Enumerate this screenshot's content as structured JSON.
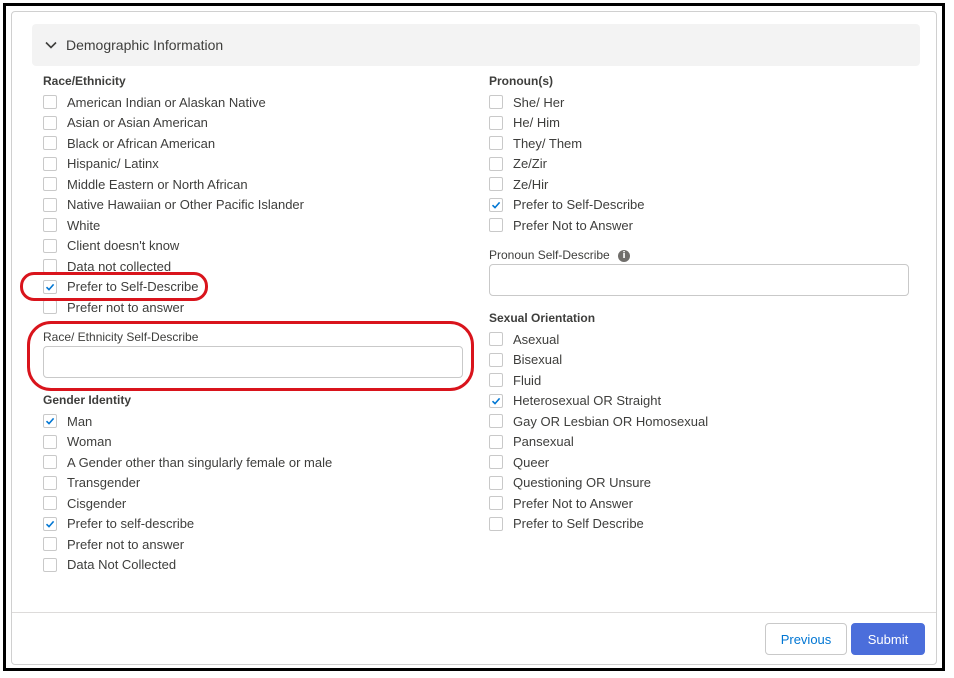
{
  "section": {
    "title": "Demographic Information",
    "icon": "chevron-down-icon"
  },
  "race": {
    "label": "Race/Ethnicity",
    "options": [
      {
        "label": "American Indian or Alaskan Native",
        "checked": false
      },
      {
        "label": "Asian or Asian American",
        "checked": false
      },
      {
        "label": "Black or African American",
        "checked": false
      },
      {
        "label": "Hispanic/ Latinx",
        "checked": false
      },
      {
        "label": "Middle Eastern or North African",
        "checked": false
      },
      {
        "label": "Native Hawaiian or Other Pacific Islander",
        "checked": false
      },
      {
        "label": "White",
        "checked": false
      },
      {
        "label": "Client doesn't know",
        "checked": false
      },
      {
        "label": "Data not collected",
        "checked": false
      },
      {
        "label": "Prefer to Self-Describe",
        "checked": true
      },
      {
        "label": "Prefer not to answer",
        "checked": false
      }
    ],
    "self_describe_label": "Race/ Ethnicity Self-Describe",
    "self_describe_value": ""
  },
  "gender": {
    "label": "Gender Identity",
    "options": [
      {
        "label": "Man",
        "checked": true
      },
      {
        "label": "Woman",
        "checked": false
      },
      {
        "label": "A Gender other than singularly female or male",
        "checked": false
      },
      {
        "label": "Transgender",
        "checked": false
      },
      {
        "label": "Cisgender",
        "checked": false
      },
      {
        "label": "Prefer to self-describe",
        "checked": true
      },
      {
        "label": "Prefer not to answer",
        "checked": false
      },
      {
        "label": "Data Not Collected",
        "checked": false
      }
    ]
  },
  "pronoun": {
    "label": "Pronoun(s)",
    "options": [
      {
        "label": "She/ Her",
        "checked": false
      },
      {
        "label": "He/ Him",
        "checked": false
      },
      {
        "label": "They/ Them",
        "checked": false
      },
      {
        "label": "Ze/Zir",
        "checked": false
      },
      {
        "label": "Ze/Hir",
        "checked": false
      },
      {
        "label": "Prefer to Self-Describe",
        "checked": true
      },
      {
        "label": "Prefer Not to Answer",
        "checked": false
      }
    ],
    "self_describe_label": "Pronoun Self-Describe",
    "self_describe_value": "",
    "info_icon": "info-icon"
  },
  "orientation": {
    "label": "Sexual Orientation",
    "options": [
      {
        "label": "Asexual",
        "checked": false
      },
      {
        "label": "Bisexual",
        "checked": false
      },
      {
        "label": "Fluid",
        "checked": false
      },
      {
        "label": "Heterosexual OR Straight",
        "checked": true
      },
      {
        "label": "Gay OR Lesbian OR Homosexual",
        "checked": false
      },
      {
        "label": "Pansexual",
        "checked": false
      },
      {
        "label": "Queer",
        "checked": false
      },
      {
        "label": "Questioning OR Unsure",
        "checked": false
      },
      {
        "label": "Prefer Not to Answer",
        "checked": false
      },
      {
        "label": "Prefer to Self Describe",
        "checked": false
      }
    ]
  },
  "buttons": {
    "previous": "Previous",
    "submit": "Submit"
  },
  "colors": {
    "accent": "#4b6edb",
    "check": "#0176d3",
    "annotation": "#d9141c"
  }
}
